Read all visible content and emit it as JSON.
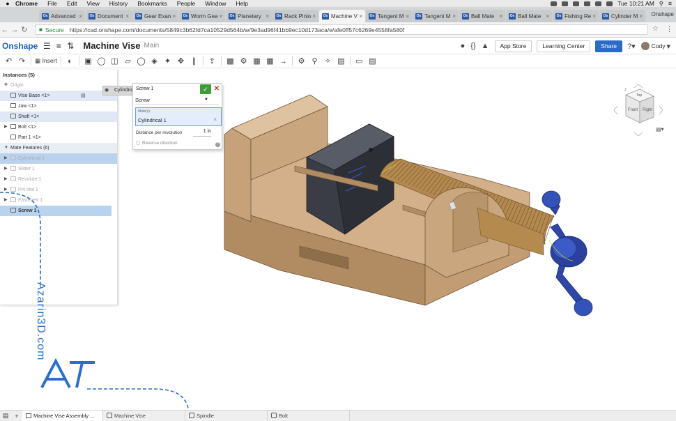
{
  "os_menubar": {
    "apple_icon": "apple-logo-icon",
    "items": [
      "Chrome",
      "File",
      "Edit",
      "View",
      "History",
      "Bookmarks",
      "People",
      "Window",
      "Help"
    ],
    "clock": "Tue 10:21 AM"
  },
  "browser": {
    "tabs": [
      {
        "label": "Advanced"
      },
      {
        "label": "Document"
      },
      {
        "label": "Gear Exan"
      },
      {
        "label": "Worm Gea"
      },
      {
        "label": "Planetary"
      },
      {
        "label": "Rack Pinio"
      },
      {
        "label": "Machine V",
        "active": true
      },
      {
        "label": "Tangent M"
      },
      {
        "label": "Tangent M"
      },
      {
        "label": "Ball Mate"
      },
      {
        "label": "Ball Mate"
      },
      {
        "label": "Fishing Re"
      },
      {
        "label": "Cylinder M"
      }
    ],
    "tab_favicon_text": "Os",
    "profile_name": "Onshape",
    "secure_label": "Secure",
    "url": "https://cad.onshape.com/documents/5849c3b62fd7ca10529d564b/w/9e3ad96f41bb9ec10d173aca/e/afe0ff57c6269e4558fa580f"
  },
  "header": {
    "logo": "Onshape",
    "document_title": "Machine Vise",
    "workspace": "Main",
    "app_store_label": "App Store",
    "learning_center_label": "Learning Center",
    "share_label": "Share",
    "user_name": "Cody",
    "accent_color": "#2a6bc6"
  },
  "toolbar": {
    "insert_label": "Insert"
  },
  "instances": {
    "header": "Instances (5)",
    "origin": "Origin",
    "parts": [
      {
        "label": "Vise Base <1>"
      },
      {
        "label": "Jaw <1>"
      },
      {
        "label": "Shaft <1>"
      },
      {
        "label": "Bolt <1>"
      },
      {
        "label": "Part 1 <1>"
      }
    ],
    "mate_header": "Mate Features (6)",
    "mates": [
      {
        "label": "Cylindrical 1"
      },
      {
        "label": "Slider 1"
      },
      {
        "label": "Revolute 1"
      },
      {
        "label": "Pin slot 1"
      },
      {
        "label": "Fastened 1"
      },
      {
        "label": "Screw 1"
      }
    ],
    "hover_tip": "Cylindrical 1"
  },
  "mate_dialog": {
    "title": "Screw 1",
    "type_value": "Screw",
    "mates_label": "Mate(s)",
    "mates_value": "Cylindrical 1",
    "distance_label": "Distance per revolution",
    "distance_value": "1 in",
    "reverse_label": "Reverse direction",
    "help_glyph": "?"
  },
  "view_cube": {
    "front": "Front",
    "top": "Top",
    "right": "Right",
    "axis_z": "Z"
  },
  "watermark": {
    "text": "Azarin3D.com",
    "color": "#2a6fcb"
  },
  "bottom_tabs": [
    {
      "label": "Machine Vise Assembly ..."
    },
    {
      "label": "Machine Vise"
    },
    {
      "label": "Spindle"
    },
    {
      "label": "Bolt"
    }
  ],
  "colors": {
    "wood": "#c9a47b",
    "jaw": "#3c3f47",
    "handle": "#2e46a7"
  }
}
